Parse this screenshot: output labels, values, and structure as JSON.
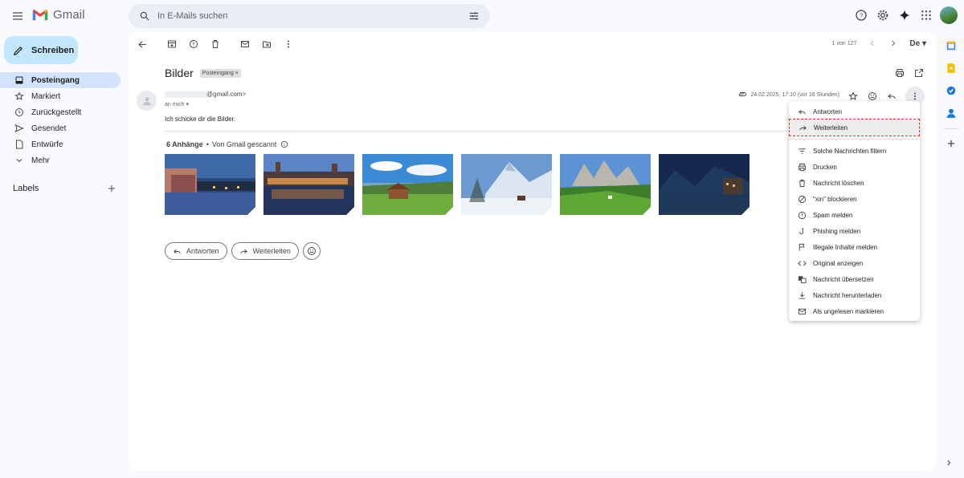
{
  "app": {
    "name": "Gmail"
  },
  "search": {
    "placeholder": "In E-Mails suchen"
  },
  "compose": {
    "label": "Schreiben"
  },
  "nav": {
    "items": [
      {
        "label": "Posteingang",
        "icon": "inbox-icon",
        "active": true
      },
      {
        "label": "Markiert",
        "icon": "star-icon"
      },
      {
        "label": "Zurückgestellt",
        "icon": "clock-icon"
      },
      {
        "label": "Gesendet",
        "icon": "send-icon"
      },
      {
        "label": "Entwürfe",
        "icon": "draft-icon"
      },
      {
        "label": "Mehr",
        "icon": "chevron-down-icon"
      }
    ],
    "labels_heading": "Labels"
  },
  "pager": {
    "text": "1 von 127",
    "lang": "De"
  },
  "email": {
    "subject": "Bilder",
    "label_chip": "Posteingang ×",
    "sender_domain": "@gmail.com>",
    "to": "an mich",
    "date": "24.02.2025, 17:10 (vor 16 Stunden)",
    "body": "Ich schicke dir die Bilder.",
    "attachments_count": "6 Anhänge",
    "scanned_text": "Von Gmail gescannt"
  },
  "reply_buttons": {
    "reply": "Antworten",
    "forward": "Weiterleiten"
  },
  "menu": {
    "items": [
      {
        "label": "Antworten",
        "icon": "reply-icon"
      },
      {
        "label": "Weiterleiten",
        "icon": "forward-icon",
        "highlighted": true
      },
      {
        "label": "Solche Nachrichten filtern",
        "icon": "filter-icon"
      },
      {
        "label": "Drucken",
        "icon": "print-icon"
      },
      {
        "label": "Nachricht löschen",
        "icon": "trash-icon"
      },
      {
        "label": "\"xin\" blockieren",
        "icon": "block-icon"
      },
      {
        "label": "Spam melden",
        "icon": "report-icon"
      },
      {
        "label": "Phishing melden",
        "icon": "phishing-icon"
      },
      {
        "label": "Illegale Inhalte melden",
        "icon": "flag-icon"
      },
      {
        "label": "Original anzeigen",
        "icon": "code-icon"
      },
      {
        "label": "Nachricht übersetzen",
        "icon": "translate-icon"
      },
      {
        "label": "Nachricht herunterladen",
        "icon": "download-icon"
      },
      {
        "label": "Als ungelesen markieren",
        "icon": "mark-unread-icon"
      }
    ]
  },
  "colors": {
    "accent": "#c2e7ff",
    "active_nav": "#d3e3fd",
    "highlight": "#d93025"
  }
}
